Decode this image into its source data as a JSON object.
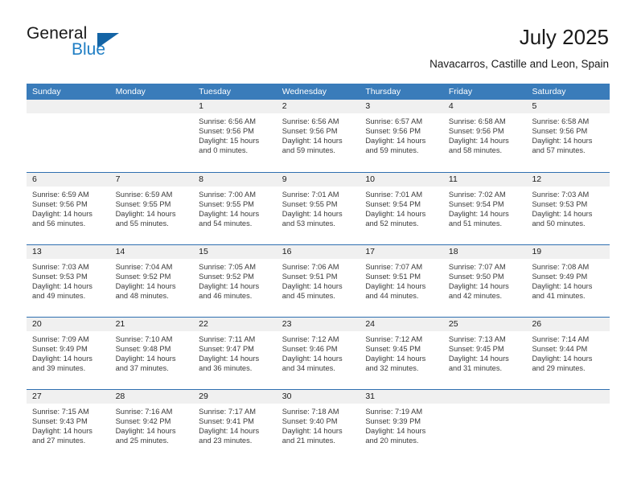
{
  "brand": {
    "name_part1": "General",
    "name_part2": "Blue",
    "accent_color": "#1f7ec4",
    "flag_color": "#1464a5"
  },
  "header": {
    "title": "July 2025",
    "subtitle": "Navacarros, Castille and Leon, Spain"
  },
  "calendar": {
    "header_bg": "#3a7cba",
    "row_divider": "#2f6fb0",
    "daynum_band_bg": "#f0f0f0",
    "weekdays": [
      "Sunday",
      "Monday",
      "Tuesday",
      "Wednesday",
      "Thursday",
      "Friday",
      "Saturday"
    ],
    "weeks": [
      [
        {
          "day": "",
          "sunrise": "",
          "sunset": "",
          "daylight": "",
          "empty": true
        },
        {
          "day": "",
          "sunrise": "",
          "sunset": "",
          "daylight": "",
          "empty": true
        },
        {
          "day": "1",
          "sunrise": "Sunrise: 6:56 AM",
          "sunset": "Sunset: 9:56 PM",
          "daylight": "Daylight: 15 hours and 0 minutes."
        },
        {
          "day": "2",
          "sunrise": "Sunrise: 6:56 AM",
          "sunset": "Sunset: 9:56 PM",
          "daylight": "Daylight: 14 hours and 59 minutes."
        },
        {
          "day": "3",
          "sunrise": "Sunrise: 6:57 AM",
          "sunset": "Sunset: 9:56 PM",
          "daylight": "Daylight: 14 hours and 59 minutes."
        },
        {
          "day": "4",
          "sunrise": "Sunrise: 6:58 AM",
          "sunset": "Sunset: 9:56 PM",
          "daylight": "Daylight: 14 hours and 58 minutes."
        },
        {
          "day": "5",
          "sunrise": "Sunrise: 6:58 AM",
          "sunset": "Sunset: 9:56 PM",
          "daylight": "Daylight: 14 hours and 57 minutes."
        }
      ],
      [
        {
          "day": "6",
          "sunrise": "Sunrise: 6:59 AM",
          "sunset": "Sunset: 9:56 PM",
          "daylight": "Daylight: 14 hours and 56 minutes."
        },
        {
          "day": "7",
          "sunrise": "Sunrise: 6:59 AM",
          "sunset": "Sunset: 9:55 PM",
          "daylight": "Daylight: 14 hours and 55 minutes."
        },
        {
          "day": "8",
          "sunrise": "Sunrise: 7:00 AM",
          "sunset": "Sunset: 9:55 PM",
          "daylight": "Daylight: 14 hours and 54 minutes."
        },
        {
          "day": "9",
          "sunrise": "Sunrise: 7:01 AM",
          "sunset": "Sunset: 9:55 PM",
          "daylight": "Daylight: 14 hours and 53 minutes."
        },
        {
          "day": "10",
          "sunrise": "Sunrise: 7:01 AM",
          "sunset": "Sunset: 9:54 PM",
          "daylight": "Daylight: 14 hours and 52 minutes."
        },
        {
          "day": "11",
          "sunrise": "Sunrise: 7:02 AM",
          "sunset": "Sunset: 9:54 PM",
          "daylight": "Daylight: 14 hours and 51 minutes."
        },
        {
          "day": "12",
          "sunrise": "Sunrise: 7:03 AM",
          "sunset": "Sunset: 9:53 PM",
          "daylight": "Daylight: 14 hours and 50 minutes."
        }
      ],
      [
        {
          "day": "13",
          "sunrise": "Sunrise: 7:03 AM",
          "sunset": "Sunset: 9:53 PM",
          "daylight": "Daylight: 14 hours and 49 minutes."
        },
        {
          "day": "14",
          "sunrise": "Sunrise: 7:04 AM",
          "sunset": "Sunset: 9:52 PM",
          "daylight": "Daylight: 14 hours and 48 minutes."
        },
        {
          "day": "15",
          "sunrise": "Sunrise: 7:05 AM",
          "sunset": "Sunset: 9:52 PM",
          "daylight": "Daylight: 14 hours and 46 minutes."
        },
        {
          "day": "16",
          "sunrise": "Sunrise: 7:06 AM",
          "sunset": "Sunset: 9:51 PM",
          "daylight": "Daylight: 14 hours and 45 minutes."
        },
        {
          "day": "17",
          "sunrise": "Sunrise: 7:07 AM",
          "sunset": "Sunset: 9:51 PM",
          "daylight": "Daylight: 14 hours and 44 minutes."
        },
        {
          "day": "18",
          "sunrise": "Sunrise: 7:07 AM",
          "sunset": "Sunset: 9:50 PM",
          "daylight": "Daylight: 14 hours and 42 minutes."
        },
        {
          "day": "19",
          "sunrise": "Sunrise: 7:08 AM",
          "sunset": "Sunset: 9:49 PM",
          "daylight": "Daylight: 14 hours and 41 minutes."
        }
      ],
      [
        {
          "day": "20",
          "sunrise": "Sunrise: 7:09 AM",
          "sunset": "Sunset: 9:49 PM",
          "daylight": "Daylight: 14 hours and 39 minutes."
        },
        {
          "day": "21",
          "sunrise": "Sunrise: 7:10 AM",
          "sunset": "Sunset: 9:48 PM",
          "daylight": "Daylight: 14 hours and 37 minutes."
        },
        {
          "day": "22",
          "sunrise": "Sunrise: 7:11 AM",
          "sunset": "Sunset: 9:47 PM",
          "daylight": "Daylight: 14 hours and 36 minutes."
        },
        {
          "day": "23",
          "sunrise": "Sunrise: 7:12 AM",
          "sunset": "Sunset: 9:46 PM",
          "daylight": "Daylight: 14 hours and 34 minutes."
        },
        {
          "day": "24",
          "sunrise": "Sunrise: 7:12 AM",
          "sunset": "Sunset: 9:45 PM",
          "daylight": "Daylight: 14 hours and 32 minutes."
        },
        {
          "day": "25",
          "sunrise": "Sunrise: 7:13 AM",
          "sunset": "Sunset: 9:45 PM",
          "daylight": "Daylight: 14 hours and 31 minutes."
        },
        {
          "day": "26",
          "sunrise": "Sunrise: 7:14 AM",
          "sunset": "Sunset: 9:44 PM",
          "daylight": "Daylight: 14 hours and 29 minutes."
        }
      ],
      [
        {
          "day": "27",
          "sunrise": "Sunrise: 7:15 AM",
          "sunset": "Sunset: 9:43 PM",
          "daylight": "Daylight: 14 hours and 27 minutes."
        },
        {
          "day": "28",
          "sunrise": "Sunrise: 7:16 AM",
          "sunset": "Sunset: 9:42 PM",
          "daylight": "Daylight: 14 hours and 25 minutes."
        },
        {
          "day": "29",
          "sunrise": "Sunrise: 7:17 AM",
          "sunset": "Sunset: 9:41 PM",
          "daylight": "Daylight: 14 hours and 23 minutes."
        },
        {
          "day": "30",
          "sunrise": "Sunrise: 7:18 AM",
          "sunset": "Sunset: 9:40 PM",
          "daylight": "Daylight: 14 hours and 21 minutes."
        },
        {
          "day": "31",
          "sunrise": "Sunrise: 7:19 AM",
          "sunset": "Sunset: 9:39 PM",
          "daylight": "Daylight: 14 hours and 20 minutes."
        },
        {
          "day": "",
          "sunrise": "",
          "sunset": "",
          "daylight": "",
          "empty": true
        },
        {
          "day": "",
          "sunrise": "",
          "sunset": "",
          "daylight": "",
          "empty": true
        }
      ]
    ]
  }
}
